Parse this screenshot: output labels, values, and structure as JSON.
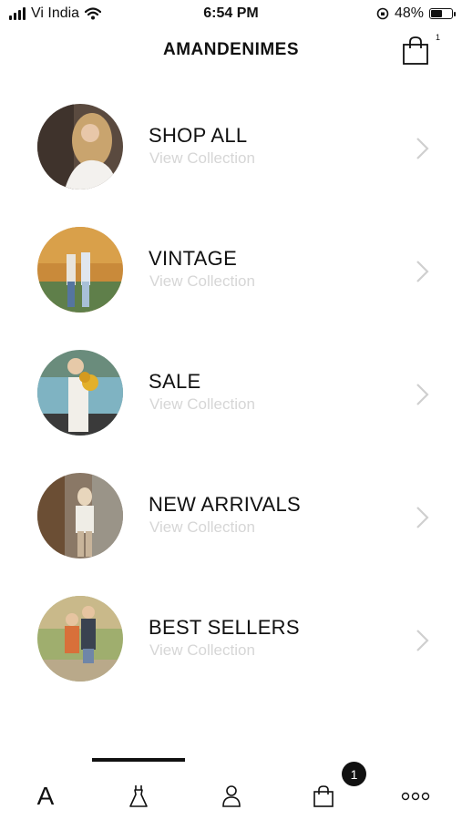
{
  "status_bar": {
    "carrier": "Vi India",
    "time": "6:54 PM",
    "battery_percent": "48%",
    "battery_level": 0.48
  },
  "header": {
    "brand": "AMANDENIMES",
    "cart_count": "1"
  },
  "collections": [
    {
      "title": "SHOP ALL",
      "subtitle": "View Collection"
    },
    {
      "title": "VINTAGE",
      "subtitle": "View Collection"
    },
    {
      "title": "SALE",
      "subtitle": "View Collection"
    },
    {
      "title": "NEW ARRIVALS",
      "subtitle": "View Collection"
    },
    {
      "title": "BEST SELLERS",
      "subtitle": "View Collection"
    }
  ],
  "tab_bar": {
    "home_label": "A",
    "cart_badge": "1",
    "icons": [
      "dress-icon",
      "person-icon",
      "bag-icon",
      "more-icon"
    ]
  },
  "colors": {
    "text": "#111111",
    "subtitle": "#d6d6d6",
    "chevron": "#cfcfcf"
  }
}
